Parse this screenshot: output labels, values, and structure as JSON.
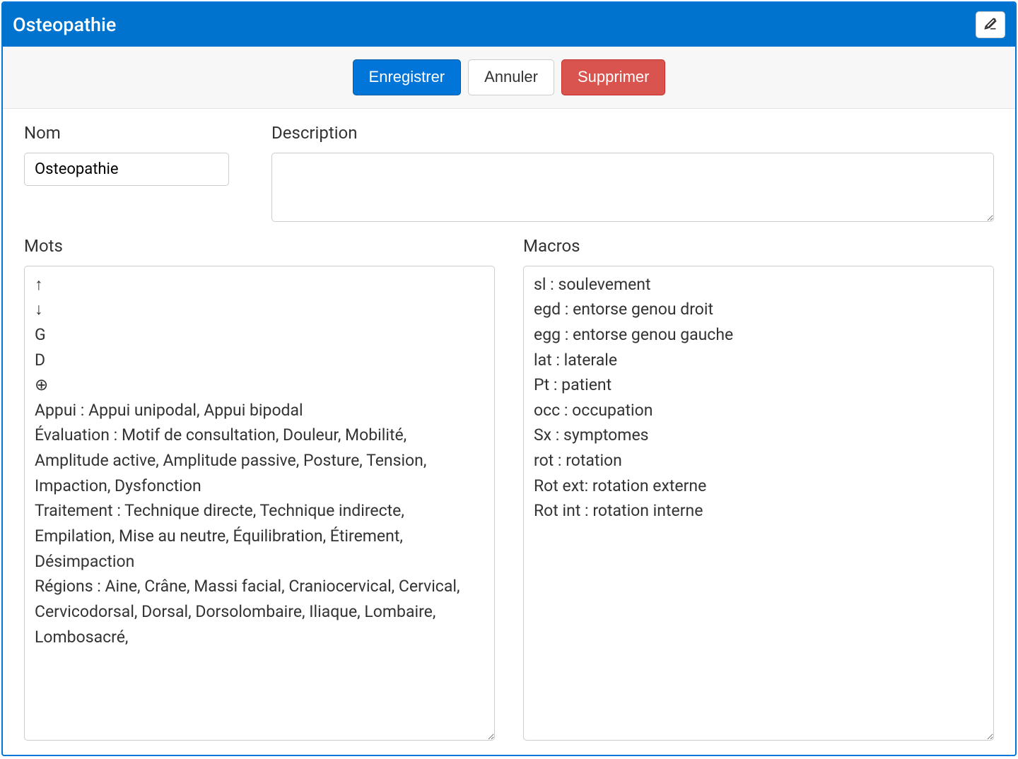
{
  "title": "Osteopathie",
  "toolbar": {
    "save_label": "Enregistrer",
    "cancel_label": "Annuler",
    "delete_label": "Supprimer"
  },
  "labels": {
    "nom": "Nom",
    "description": "Description",
    "mots": "Mots",
    "macros": "Macros"
  },
  "fields": {
    "nom_value": "Osteopathie",
    "description_value": "",
    "mots_value": "↑\n↓\nG\nD\n⊕\nAppui : Appui unipodal, Appui bipodal\nÉvaluation : Motif de consultation, Douleur, Mobilité, Amplitude active, Amplitude passive, Posture, Tension, Impaction, Dysfonction\nTraitement : Technique directe, Technique indirecte, Empilation, Mise au neutre, Équilibration, Étirement, Désimpaction\nRégions : Aine, Crâne, Massi facial, Craniocervical, Cervical, Cervicodorsal, Dorsal, Dorsolombaire, Iliaque, Lombaire, Lombosacré,",
    "macros_value": "sl : soulevement\negd : entorse genou droit\negg : entorse genou gauche\nlat : laterale\nPt : patient\nocc : occupation\nSx : symptomes\nrot : rotation\nRot ext: rotation externe\nRot int : rotation interne"
  }
}
